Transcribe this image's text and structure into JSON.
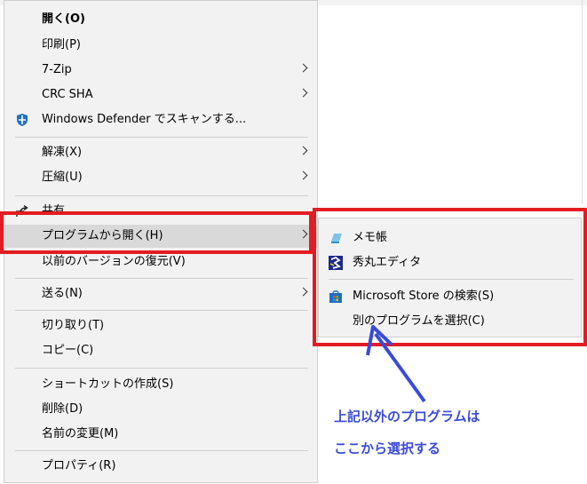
{
  "menu": {
    "items": [
      {
        "label": "開く(O)"
      },
      {
        "label": "印刷(P)"
      },
      {
        "label": "7-Zip"
      },
      {
        "label": "CRC SHA"
      },
      {
        "label": "Windows Defender でスキャンする..."
      },
      {
        "label": "解凍(X)"
      },
      {
        "label": "圧縮(U)"
      },
      {
        "label": "共有"
      },
      {
        "label": "プログラムから開く(H)"
      },
      {
        "label": "以前のバージョンの復元(V)"
      },
      {
        "label": "送る(N)"
      },
      {
        "label": "切り取り(T)"
      },
      {
        "label": "コピー(C)"
      },
      {
        "label": "ショートカットの作成(S)"
      },
      {
        "label": "削除(D)"
      },
      {
        "label": "名前の変更(M)"
      },
      {
        "label": "プロパティ(R)"
      }
    ]
  },
  "submenu": {
    "items": [
      {
        "label": "メモ帳"
      },
      {
        "label": "秀丸エディタ"
      },
      {
        "label": "Microsoft Store の検索(S)"
      },
      {
        "label": "別のプログラムを選択(C)"
      }
    ]
  },
  "annotation": {
    "line1": "上記以外のプログラムは",
    "line2": "ここから選択する"
  },
  "icons": {
    "defender": "shield-icon",
    "share": "share-icon",
    "notepad": "notepad-icon",
    "hidemaru": "hidemaru-icon",
    "store": "store-icon"
  },
  "colors": {
    "highlight_box": "#e31c23",
    "annotation": "#3a4bd8",
    "defender": "#1f6fc4",
    "store": "#1f6fc4"
  }
}
